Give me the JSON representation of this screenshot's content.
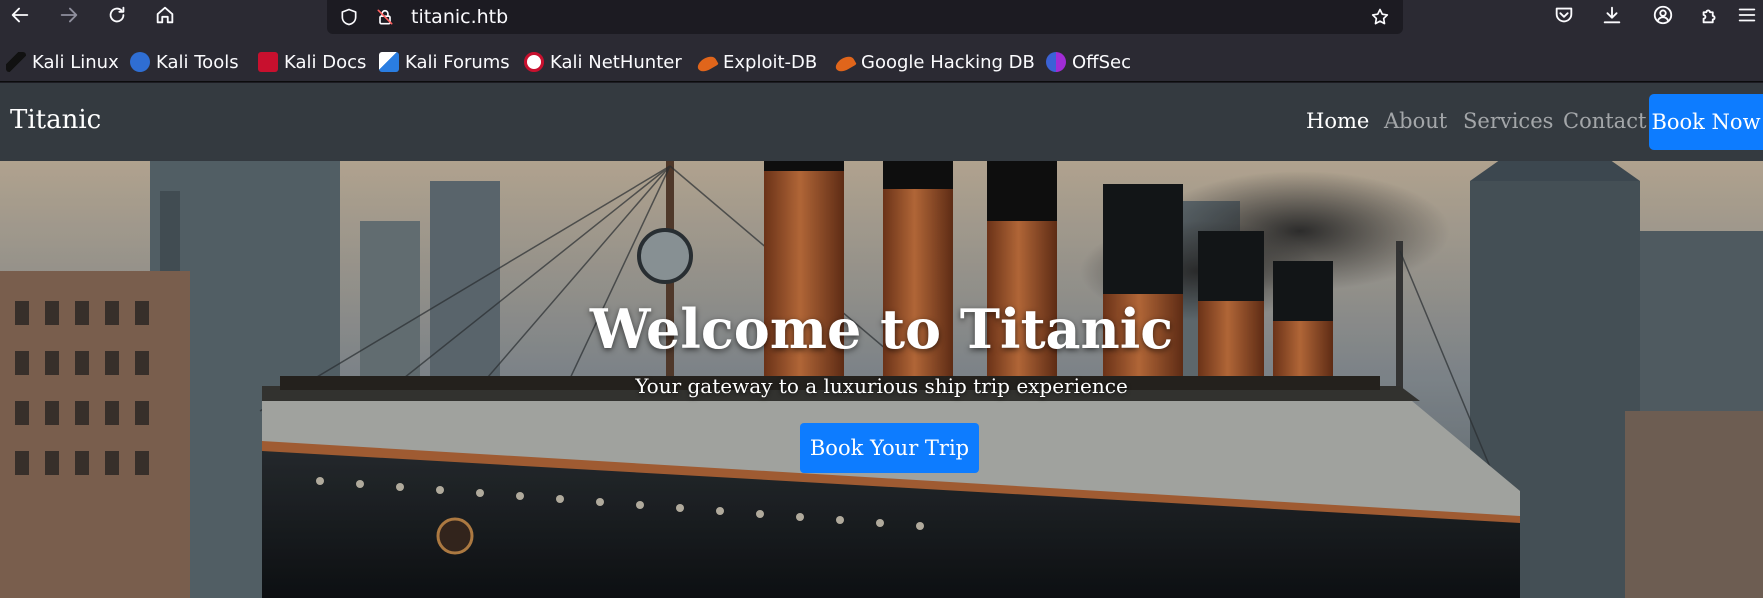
{
  "browser": {
    "url": "titanic.htb",
    "icons": {
      "back": "arrow-left-icon",
      "forward": "arrow-right-icon",
      "reload": "reload-icon",
      "home": "home-icon",
      "tracking": "shield-icon",
      "connection": "lock-icon",
      "bookmark": "star-icon",
      "pocket": "pocket-icon",
      "downloads": "download-icon",
      "account": "account-icon",
      "extensions": "extensions-icon",
      "menu": "hamburger-menu-icon"
    }
  },
  "bookmarks": [
    {
      "label": "Kali Linux",
      "color": "#1a1a1a"
    },
    {
      "label": "Kali Tools",
      "color": "#2f6ed3"
    },
    {
      "label": "Kali Docs",
      "color": "#c8102e"
    },
    {
      "label": "Kali Forums",
      "color": "#2a7de1"
    },
    {
      "label": "Kali NetHunter",
      "color": "#c8102e"
    },
    {
      "label": "Exploit-DB",
      "color": "#e0651b"
    },
    {
      "label": "Google Hacking DB",
      "color": "#e0651b"
    },
    {
      "label": "OffSec",
      "color": "#3b62d6"
    }
  ],
  "site": {
    "brand": "Titanic",
    "nav": {
      "home": "Home",
      "about": "About",
      "services": "Services",
      "contact": "Contact",
      "book_now": "Book Now"
    },
    "hero": {
      "title": "Welcome to Titanic",
      "subtitle": "Your gateway to a luxurious ship trip experience",
      "button": "Book Your Trip"
    }
  },
  "colors": {
    "accent": "#0d7cff",
    "navbar": "#343a40",
    "browser_chrome": "#2b2a33"
  }
}
